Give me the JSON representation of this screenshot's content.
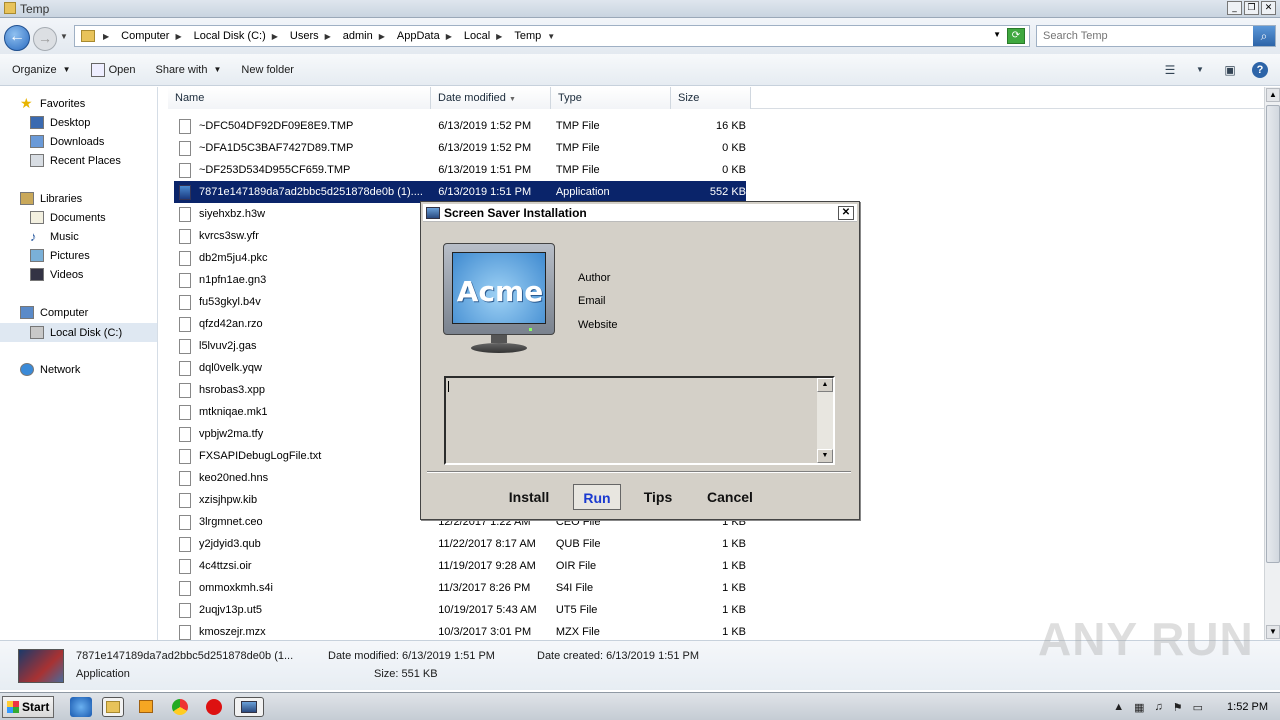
{
  "window": {
    "title": "Temp"
  },
  "address": {
    "breadcrumbs": [
      "Computer",
      "Local Disk (C:)",
      "Users",
      "admin",
      "AppData",
      "Local",
      "Temp"
    ],
    "search_placeholder": "Search Temp"
  },
  "toolbar": {
    "organize": "Organize",
    "open": "Open",
    "share_with": "Share with",
    "new_folder": "New folder"
  },
  "nav": {
    "favorites": "Favorites",
    "desktop": "Desktop",
    "downloads": "Downloads",
    "recent_places": "Recent Places",
    "libraries": "Libraries",
    "documents": "Documents",
    "music": "Music",
    "pictures": "Pictures",
    "videos": "Videos",
    "computer": "Computer",
    "local_disk": "Local Disk (C:)",
    "network": "Network"
  },
  "columns": {
    "name": "Name",
    "date_modified": "Date modified",
    "type": "Type",
    "size": "Size"
  },
  "files": [
    {
      "name": "~DFC504DF92DF09E8E9.TMP",
      "date": "6/13/2019 1:52 PM",
      "type": "TMP File",
      "size": "16 KB"
    },
    {
      "name": "~DFA1D5C3BAF7427D89.TMP",
      "date": "6/13/2019 1:52 PM",
      "type": "TMP File",
      "size": "0 KB"
    },
    {
      "name": "~DF253D534D955CF659.TMP",
      "date": "6/13/2019 1:51 PM",
      "type": "TMP File",
      "size": "0 KB"
    },
    {
      "name": "7871e147189da7ad2bbc5d251878de0b (1)....",
      "date": "6/13/2019 1:51 PM",
      "type": "Application",
      "size": "552 KB"
    },
    {
      "name": "siyehxbz.h3w",
      "date": "",
      "type": "",
      "size": ""
    },
    {
      "name": "kvrcs3sw.yfr",
      "date": "",
      "type": "",
      "size": ""
    },
    {
      "name": "db2m5ju4.pkc",
      "date": "",
      "type": "",
      "size": ""
    },
    {
      "name": "n1pfn1ae.gn3",
      "date": "",
      "type": "",
      "size": ""
    },
    {
      "name": "fu53gkyl.b4v",
      "date": "",
      "type": "",
      "size": ""
    },
    {
      "name": "qfzd42an.rzo",
      "date": "",
      "type": "",
      "size": ""
    },
    {
      "name": "l5lvuv2j.gas",
      "date": "",
      "type": "",
      "size": ""
    },
    {
      "name": "dql0velk.yqw",
      "date": "",
      "type": "",
      "size": ""
    },
    {
      "name": "hsrobas3.xpp",
      "date": "",
      "type": "",
      "size": ""
    },
    {
      "name": "mtkniqae.mk1",
      "date": "",
      "type": "",
      "size": ""
    },
    {
      "name": "vpbjw2ma.tfy",
      "date": "",
      "type": "",
      "size": ""
    },
    {
      "name": "FXSAPIDebugLogFile.txt",
      "date": "",
      "type": "",
      "size": ""
    },
    {
      "name": "keo20ned.hns",
      "date": "",
      "type": "",
      "size": ""
    },
    {
      "name": "xzisjhpw.kib",
      "date": "",
      "type": "",
      "size": ""
    },
    {
      "name": "3lrgmnet.ceo",
      "date": "12/2/2017 1:22 AM",
      "type": "CEO File",
      "size": "1 KB"
    },
    {
      "name": "y2jdyid3.qub",
      "date": "11/22/2017 8:17 AM",
      "type": "QUB File",
      "size": "1 KB"
    },
    {
      "name": "4c4ttzsi.oir",
      "date": "11/19/2017 9:28 AM",
      "type": "OIR File",
      "size": "1 KB"
    },
    {
      "name": "ommoxkmh.s4i",
      "date": "11/3/2017 8:26 PM",
      "type": "S4I File",
      "size": "1 KB"
    },
    {
      "name": "2uqjv13p.ut5",
      "date": "10/19/2017 5:43 AM",
      "type": "UT5 File",
      "size": "1 KB"
    },
    {
      "name": "kmoszejr.mzx",
      "date": "10/3/2017 3:01 PM",
      "type": "MZX File",
      "size": "1 KB"
    }
  ],
  "details": {
    "filename": "7871e147189da7ad2bbc5d251878de0b (1...",
    "type": "Application",
    "date_modified": "Date modified: 6/13/2019 1:51 PM",
    "date_created": "Date created: 6/13/2019 1:51 PM",
    "size": "Size: 551 KB"
  },
  "dialog": {
    "title": "Screen Saver Installation",
    "logo_text": "Acme",
    "author": "Author",
    "email": "Email",
    "website": "Website",
    "install": "Install",
    "run": "Run",
    "tips": "Tips",
    "cancel": "Cancel"
  },
  "taskbar": {
    "start": "Start",
    "time": "1:52 PM"
  },
  "watermark": "ANY RUN"
}
